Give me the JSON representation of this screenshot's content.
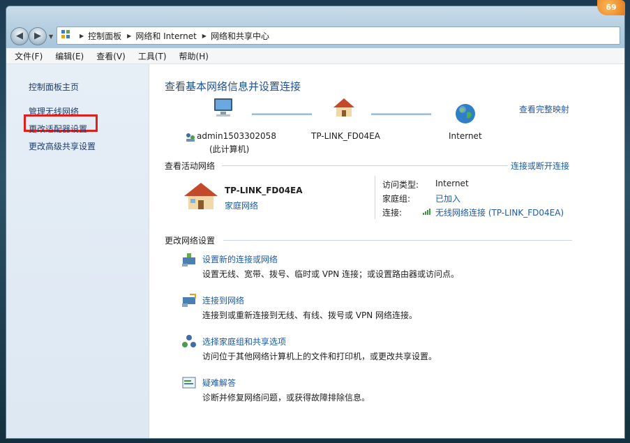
{
  "window": {
    "notification_badge": "69"
  },
  "address": {
    "breadcrumbs": [
      "控制面板",
      "网络和 Internet",
      "网络和共享中心"
    ]
  },
  "menu": [
    "文件(F)",
    "编辑(E)",
    "查看(V)",
    "工具(T)",
    "帮助(H)"
  ],
  "sidebar": {
    "items": [
      "控制面板主页",
      "管理无线网络",
      "更改适配器设置",
      "更改高级共享设置"
    ],
    "highlighted_item": "更改适配器设置",
    "highlight_color": "#e0201c"
  },
  "main": {
    "heading": "查看基本网络信息并设置连接",
    "network_map_link": "查看完整映射",
    "nodes": {
      "computer_name": "admin1503302058",
      "computer_note": "(此计算机)",
      "router": "TP-LINK_FD04EA",
      "internet": "Internet"
    },
    "active": {
      "title": "查看活动网络",
      "toggle_link": "连接或断开连接",
      "network_name": "TP-LINK_FD04EA",
      "network_type": "家庭网络",
      "access_type_label": "访问类型:",
      "access_type_value": "Internet",
      "homegroup_label": "家庭组:",
      "homegroup_value": "已加入",
      "connection_label": "连接:",
      "connection_value": "无线网络连接 (TP-LINK_FD04EA)"
    },
    "change": {
      "title": "更改网络设置",
      "tasks": [
        {
          "title": "设置新的连接或网络",
          "desc": "设置无线、宽带、拨号、临时或 VPN 连接；或设置路由器或访问点。",
          "icon": "new-connection-icon"
        },
        {
          "title": "连接到网络",
          "desc": "连接到或重新连接到无线、有线、拨号或 VPN 网络连接。",
          "icon": "connect-network-icon"
        },
        {
          "title": "选择家庭组和共享选项",
          "desc": "访问位于其他网络计算机上的文件和打印机，或更改共享设置。",
          "icon": "homegroup-icon"
        },
        {
          "title": "疑难解答",
          "desc": "诊断并修复网络问题，或获得故障排除信息。",
          "icon": "troubleshoot-icon"
        }
      ]
    }
  },
  "colors": {
    "link": "#1f5aa7",
    "heading": "#1e5096",
    "sidebar_link": "#1f3d6b"
  }
}
